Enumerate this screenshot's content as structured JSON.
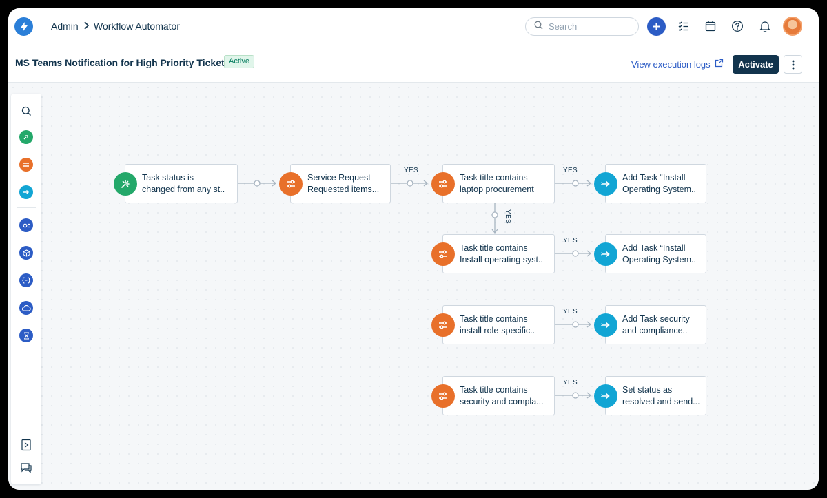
{
  "breadcrumb": {
    "root": "Admin",
    "current": "Workflow Automator"
  },
  "search": {
    "placeholder": "Search"
  },
  "header": {
    "title": "MS Teams Notification for High Priority Ticket",
    "status": "Active",
    "logs_link": "View execution logs",
    "activate_label": "Activate"
  },
  "colors": {
    "brand": "#2b7fd8",
    "event": "#24a86a",
    "condition": "#e8702a",
    "action": "#12a5d4",
    "primary_button": "#12344d",
    "link": "#2c5cc5"
  },
  "toolbar_icons": [
    "search-icon",
    "event-icon",
    "condition-icon",
    "action-icon",
    "expression-icon",
    "app-icon",
    "json-icon",
    "cloud-icon",
    "timer-icon",
    "playbook-icon",
    "feedback-icon"
  ],
  "branch_label": "YES",
  "nodes": {
    "event": {
      "text": "Task status is\nchanged from any st..",
      "icon": "event-icon"
    },
    "cond1": {
      "text": "Service Request -\nRequested items...",
      "icon": "condition-icon"
    },
    "cond2": {
      "text": "Task title contains\nlaptop procurement",
      "icon": "condition-icon"
    },
    "act1": {
      "text": "Add Task “Install\nOperating System..",
      "icon": "action-icon"
    },
    "cond3": {
      "text": "Task title contains\nInstall operating syst..",
      "icon": "condition-icon"
    },
    "act2": {
      "text": "Add Task “Install\nOperating System..",
      "icon": "action-icon"
    },
    "cond4": {
      "text": "Task title contains\ninstall role-specific..",
      "icon": "condition-icon"
    },
    "act3": {
      "text": "Add Task security\nand compliance..",
      "icon": "action-icon"
    },
    "cond5": {
      "text": "Task title contains\nsecurity and compla...",
      "icon": "condition-icon"
    },
    "act4": {
      "text": "Set status as\nresolved and send...",
      "icon": "action-icon"
    }
  }
}
